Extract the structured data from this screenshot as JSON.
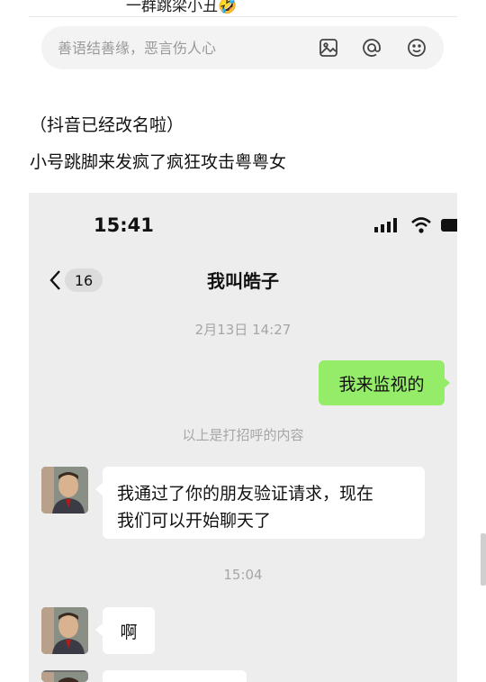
{
  "top": {
    "partial_caption": "一群跳梁小丑🤣"
  },
  "comment_bar": {
    "placeholder": "善语结善缘，恶言伤人心",
    "icons": [
      "image-icon",
      "mention-icon",
      "emoji-icon"
    ]
  },
  "post": {
    "line1": "（抖音已经改名啦）",
    "line2": "小号跳脚来发疯了疯狂攻击粤粤女"
  },
  "chat": {
    "status_time": "15:41",
    "unread_badge": "16",
    "contact_name": "我叫皓子",
    "timestamp1": "2月13日 14:27",
    "sent_message": "我来监视的",
    "greeting_hint": "以上是打招呼的内容",
    "received1_line1": "我通过了你的朋友验证请求，现在",
    "received1_line2": "我们可以开始聊天了",
    "timestamp2": "15:04",
    "received2": "啊",
    "colors": {
      "sent_bubble": "#95ec69",
      "received_bubble": "#ffffff",
      "background": "#ededed"
    }
  }
}
